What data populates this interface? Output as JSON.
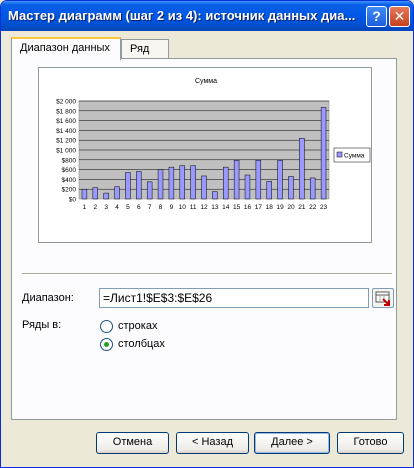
{
  "window": {
    "title": "Мастер диаграмм (шаг 2 из 4): источник данных диа...",
    "help_label": "?",
    "close_label": "✕"
  },
  "tabs": [
    {
      "label": "Диапазон данных",
      "active": true
    },
    {
      "label": "Ряд",
      "active": false
    }
  ],
  "range": {
    "label": "Диапазон:",
    "value": "=Лист1!$E$3:$E$26"
  },
  "series_in": {
    "label": "Ряды в:",
    "options": [
      {
        "label": "строках",
        "selected": false
      },
      {
        "label": "столбцах",
        "selected": true
      }
    ]
  },
  "buttons": {
    "cancel": "Отмена",
    "back": "< Назад",
    "next": "Далее >",
    "finish": "Готово"
  },
  "chart_data": {
    "type": "bar",
    "title": "Сумма",
    "categories": [
      "1",
      "2",
      "3",
      "4",
      "5",
      "6",
      "7",
      "8",
      "9",
      "10",
      "11",
      "12",
      "13",
      "14",
      "15",
      "16",
      "17",
      "18",
      "19",
      "20",
      "21",
      "22",
      "23"
    ],
    "series": [
      {
        "name": "Сумма",
        "values": [
          200,
          230,
          120,
          250,
          540,
          560,
          350,
          600,
          650,
          680,
          680,
          470,
          150,
          650,
          790,
          490,
          790,
          360,
          790,
          460,
          1240,
          430,
          1870
        ]
      }
    ],
    "ylim": [
      0,
      2000
    ],
    "yticks": [
      "$0",
      "$200",
      "$400",
      "$600",
      "$800",
      "$1 000",
      "$1 200",
      "$1 400",
      "$1 600",
      "$1 800",
      "$2 000"
    ],
    "grid": true,
    "legend": "right",
    "colors": {
      "bar": "#9999ff",
      "plot_bg": "#c0c0c0",
      "legend_swatch": "#9999ff"
    }
  }
}
